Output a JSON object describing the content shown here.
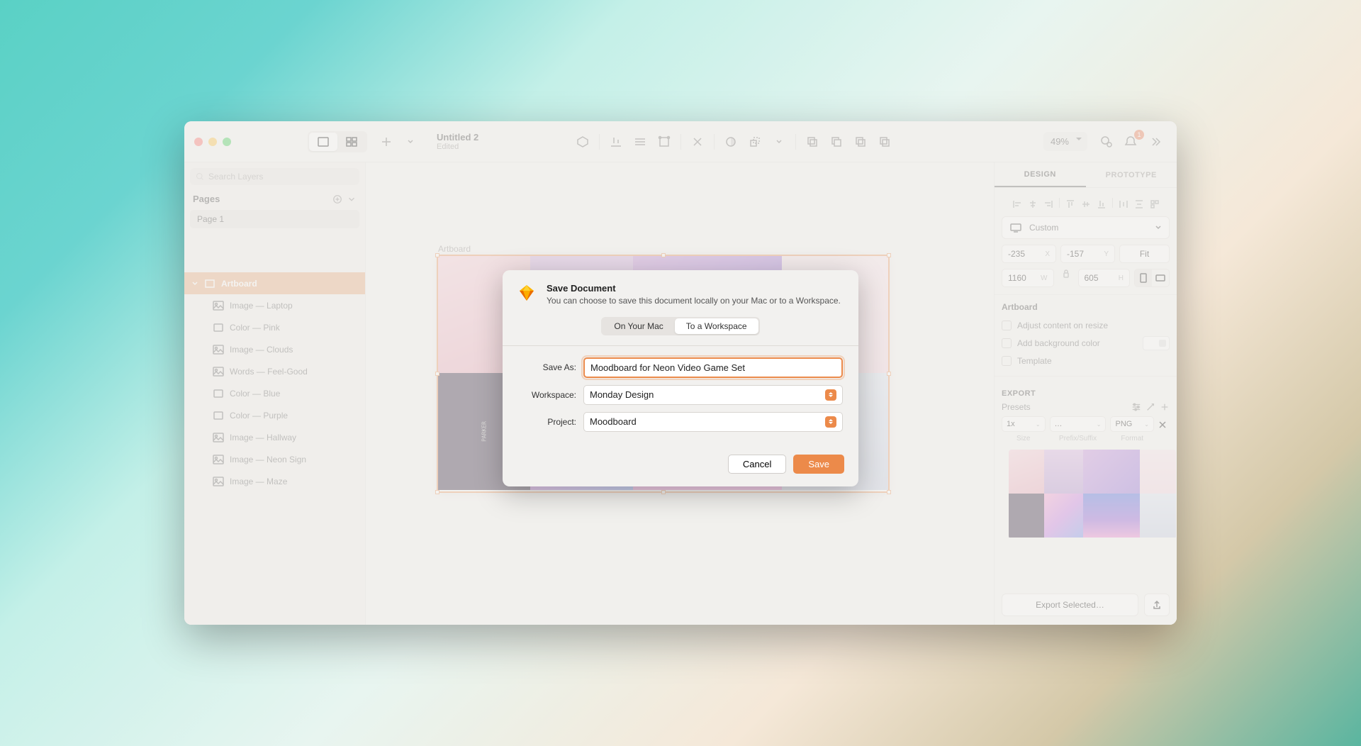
{
  "document": {
    "title": "Untitled 2",
    "status": "Edited"
  },
  "titlebar": {
    "zoom": "49%",
    "notification_count": "1"
  },
  "sidebar": {
    "search_placeholder": "Search Layers",
    "pages_label": "Pages",
    "pages": [
      {
        "name": "Page 1"
      }
    ],
    "artboard_layer": "Artboard",
    "layers": [
      {
        "name": "Image — Laptop",
        "type": "image"
      },
      {
        "name": "Color — Pink",
        "type": "color"
      },
      {
        "name": "Image — Clouds",
        "type": "image"
      },
      {
        "name": "Words — Feel-Good",
        "type": "text"
      },
      {
        "name": "Color — Blue",
        "type": "color"
      },
      {
        "name": "Color — Purple",
        "type": "color"
      },
      {
        "name": "Image — Hallway",
        "type": "image"
      },
      {
        "name": "Image — Neon Sign",
        "type": "image"
      },
      {
        "name": "Image — Maze",
        "type": "image"
      }
    ]
  },
  "canvas": {
    "artboard_label": "Artboard"
  },
  "inspector": {
    "tabs": {
      "design": "DESIGN",
      "prototype": "PROTOTYPE"
    },
    "device": "Custom",
    "x": "-235",
    "y": "-157",
    "w": "1160",
    "h": "605",
    "fit_label": "Fit",
    "section_label": "Artboard",
    "adjust_label": "Adjust content on resize",
    "bg_label": "Add background color",
    "template_label": "Template",
    "export_label": "EXPORT",
    "presets_label": "Presets",
    "size_val": "1x",
    "size_label": "Size",
    "prefix_val": "…",
    "prefix_label": "Prefix/Suffix",
    "format_val": "PNG",
    "format_label": "Format",
    "export_button": "Export Selected…"
  },
  "modal": {
    "title": "Save Document",
    "subtitle": "You can choose to save this document locally on your Mac or to a Workspace.",
    "tab_local": "On Your Mac",
    "tab_workspace": "To a Workspace",
    "saveas_label": "Save As:",
    "saveas_value": "Moodboard for Neon Video Game Set",
    "workspace_label": "Workspace:",
    "workspace_value": "Monday Design",
    "project_label": "Project:",
    "project_value": "Moodboard",
    "cancel": "Cancel",
    "save": "Save"
  }
}
